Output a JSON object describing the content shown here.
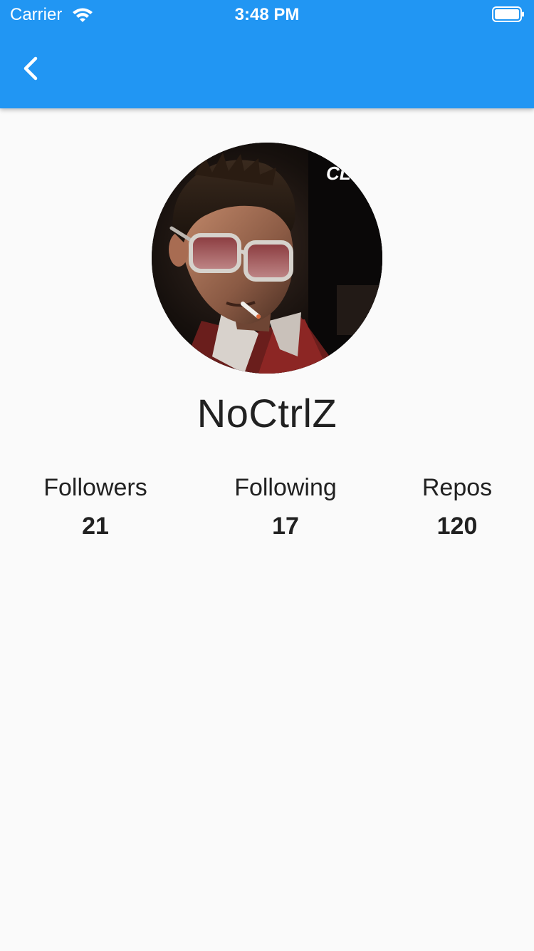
{
  "status_bar": {
    "carrier": "Carrier",
    "time": "3:48 PM"
  },
  "app_bar": {
    "color": "#2196f3",
    "back_icon": "chevron-left-icon"
  },
  "profile": {
    "username": "NoCtrlZ",
    "avatar_overlay_text": "CL"
  },
  "stats": {
    "followers": {
      "label": "Followers",
      "value": "21"
    },
    "following": {
      "label": "Following",
      "value": "17"
    },
    "repos": {
      "label": "Repos",
      "value": "120"
    }
  }
}
